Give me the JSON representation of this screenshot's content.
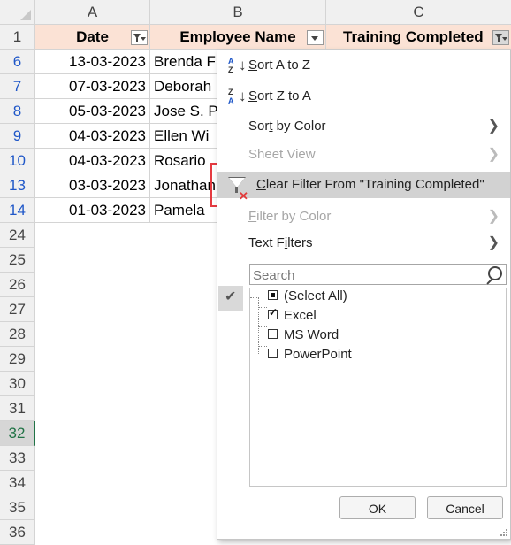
{
  "columns": {
    "a": "A",
    "b": "B",
    "c": "C"
  },
  "header_row": {
    "row_number": "1",
    "date": "Date",
    "employee": "Employee Name",
    "training": "Training Completed"
  },
  "rows": [
    {
      "num": "6",
      "date": "13-03-2023",
      "name": "Brenda F"
    },
    {
      "num": "7",
      "date": "07-03-2023",
      "name": "Deborah"
    },
    {
      "num": "8",
      "date": "05-03-2023",
      "name": "Jose S. P"
    },
    {
      "num": "9",
      "date": "04-03-2023",
      "name": "Ellen Wi"
    },
    {
      "num": "10",
      "date": "04-03-2023",
      "name": "Rosario"
    },
    {
      "num": "13",
      "date": "03-03-2023",
      "name": "Jonathan"
    },
    {
      "num": "14",
      "date": "01-03-2023",
      "name": "Pamela"
    }
  ],
  "empty_rows": [
    "24",
    "25",
    "26",
    "27",
    "28",
    "29",
    "30",
    "31",
    "32",
    "33",
    "34",
    "35",
    "36"
  ],
  "selected_row": "32",
  "menu": {
    "sort_a_to_z": "Sort A to Z",
    "sort_z_to_a": "Sort Z to A",
    "sort_by_color": "Sort by Color",
    "sheet_view": "Sheet View",
    "clear_filter": "Clear Filter From \"Training Completed\"",
    "filter_by_color": "Filter by Color",
    "text_filters": "Text Filters",
    "search_placeholder": "Search",
    "list": [
      {
        "label": "(Select All)",
        "state": "mixed"
      },
      {
        "label": "Excel",
        "state": "checked"
      },
      {
        "label": "MS Word",
        "state": "unchecked"
      },
      {
        "label": "PowerPoint",
        "state": "unchecked"
      }
    ],
    "ok": "OK",
    "cancel": "Cancel"
  },
  "colors": {
    "header_fill": "#fbe2d5",
    "filtered_row_number": "#1f57c8",
    "highlight_border": "#e53a40",
    "hover_fill": "#d2d2d2"
  },
  "icons": {
    "sort_asc": "sort-a-z-icon",
    "sort_desc": "sort-z-a-icon",
    "clear_filter": "clear-filter-icon",
    "search": "search-icon",
    "chevron": "chevron-right-icon",
    "checkmark": "checkmark-icon"
  }
}
